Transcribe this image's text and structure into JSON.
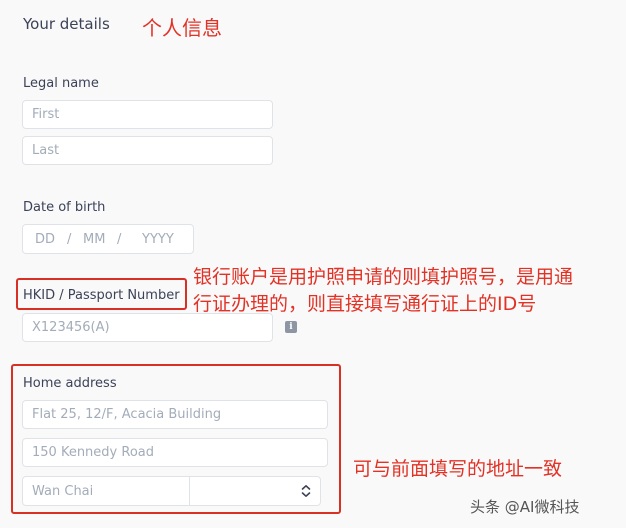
{
  "section": {
    "title": "Your details",
    "annotation": "个人信息"
  },
  "legal_name": {
    "label": "Legal name",
    "first_placeholder": "First",
    "last_placeholder": "Last"
  },
  "dob": {
    "label": "Date of birth",
    "dd": "DD",
    "mm": "MM",
    "yyyy": "YYYY",
    "sep": "/"
  },
  "hkid": {
    "label": "HKID / Passport Number",
    "placeholder": "X123456(A)",
    "info_icon": "info-icon",
    "annotation_line1": "银行账户是用护照申请的则填护照号，是用通",
    "annotation_line2": "行证办理的，则直接填写通行证上的ID号"
  },
  "address": {
    "label": "Home address",
    "line1_placeholder": "Flat 25, 12/F, Acacia Building",
    "line2_placeholder": "150 Kennedy Road",
    "district_placeholder": "Wan Chai",
    "select_value": "",
    "annotation": "可与前面填写的地址一致"
  },
  "watermark": "头条 @AI微科技",
  "colors": {
    "annotation_red": "#e23226",
    "box_red": "#d93025",
    "background": "#f9f9fa"
  }
}
